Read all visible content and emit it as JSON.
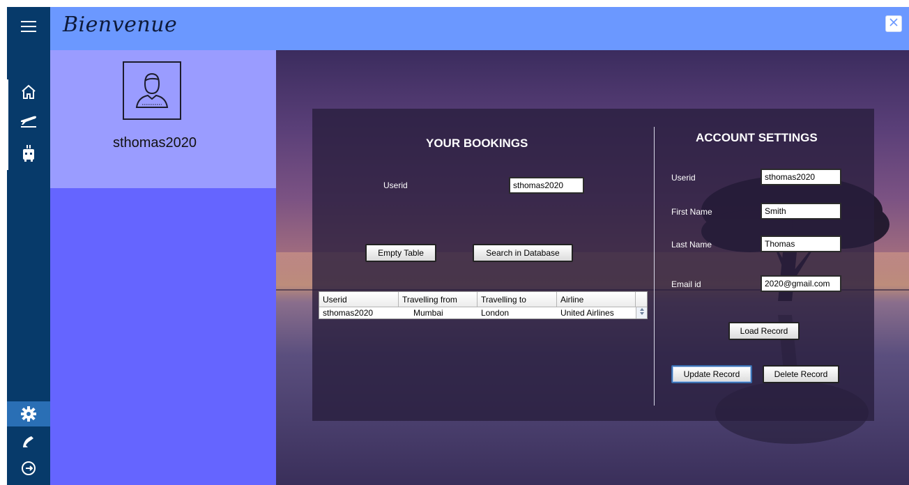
{
  "app": {
    "brand": "Bienvenue"
  },
  "profile": {
    "username": "sthomas2020"
  },
  "rail": {
    "items": [
      {
        "icon": "menu-icon"
      },
      {
        "icon": "home-icon"
      },
      {
        "icon": "flight-icon"
      },
      {
        "icon": "luggage-icon"
      },
      {
        "icon": "settings-icon",
        "active": true
      },
      {
        "icon": "phone-icon"
      },
      {
        "icon": "logout-icon"
      }
    ]
  },
  "bookings": {
    "title": "YOUR BOOKINGS",
    "userid_label": "Userid",
    "userid_value": "sthomas2020",
    "empty_table_label": "Empty Table",
    "search_label": "Search in Database",
    "table": {
      "columns": [
        "Userid",
        "Travelling from",
        "Travelling to",
        "Airline"
      ],
      "rows": [
        [
          "sthomas2020",
          "Mumbai",
          "London",
          "United Airlines"
        ]
      ]
    }
  },
  "account": {
    "title": "ACCOUNT SETTINGS",
    "userid_label": "Userid",
    "userid_value": "sthomas2020",
    "first_name_label": "First Name",
    "first_name_value": "Smith",
    "last_name_label": "Last Name",
    "last_name_value": "Thomas",
    "email_label": "Email id",
    "email_value": "2020@gmail.com",
    "load_label": "Load Record",
    "update_label": "Update Record",
    "delete_label": "Delete Record"
  },
  "colors": {
    "rail": "#073a6a",
    "header": "#6b98ff",
    "profile_top": "#9a9cff",
    "profile_bottom": "#6565ff",
    "rail_active": "#2a6fb5"
  }
}
